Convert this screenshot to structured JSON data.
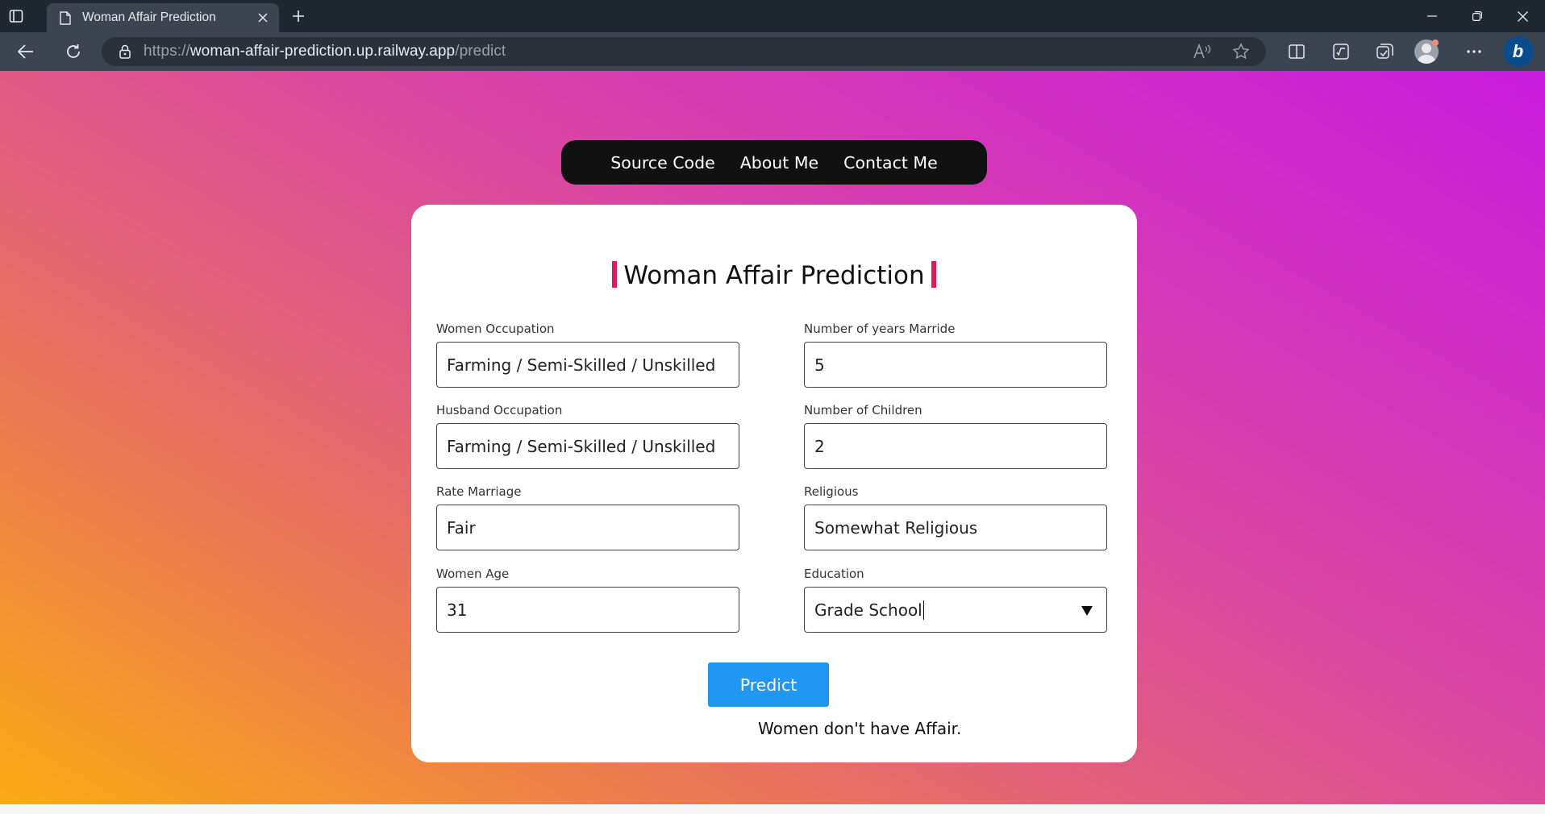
{
  "browser": {
    "tab_title": "Woman Affair Prediction",
    "url_scheme": "https://",
    "url_host": "woman-affair-prediction.up.railway.app",
    "url_path": "/predict"
  },
  "nav": {
    "source_code": "Source Code",
    "about_me": "About Me",
    "contact_me": "Contact Me"
  },
  "form": {
    "title": "Woman Affair Prediction",
    "women_occupation": {
      "label": "Women Occupation",
      "value": "Farming / Semi-Skilled / Unskilled"
    },
    "husband_occupation": {
      "label": "Husband Occupation",
      "value": "Farming / Semi-Skilled / Unskilled"
    },
    "rate_marriage": {
      "label": "Rate Marriage",
      "value": "Fair"
    },
    "women_age": {
      "label": "Women Age",
      "value": "31"
    },
    "years_married": {
      "label": "Number of years Marride",
      "value": "5"
    },
    "children": {
      "label": "Number of Children",
      "value": "2"
    },
    "religious": {
      "label": "Religious",
      "value": "Somewhat Religious"
    },
    "education": {
      "label": "Education",
      "value": "Grade School"
    },
    "predict_label": "Predict",
    "result": "Women don't have Affair."
  },
  "colors": {
    "accent_bar": "#e3185a",
    "button": "#2196f3",
    "gradient_start": "#fcac12",
    "gradient_end": "#c81bde"
  }
}
